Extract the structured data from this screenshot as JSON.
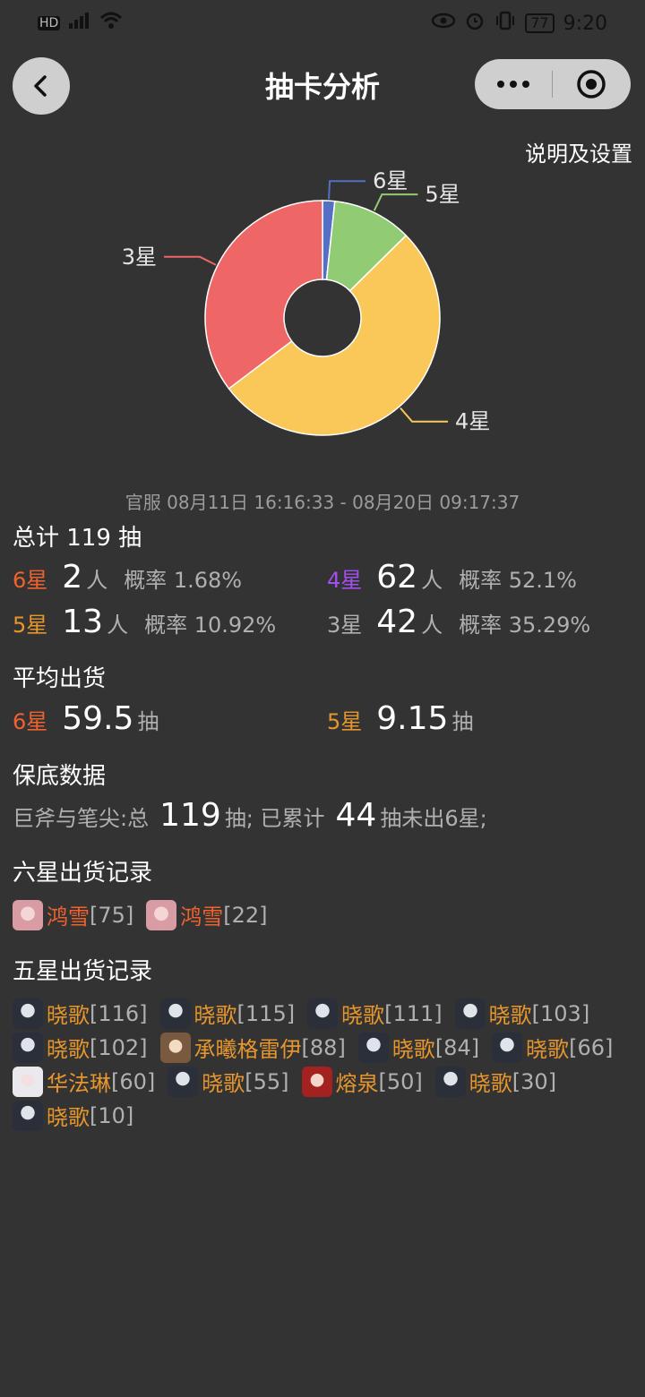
{
  "status_bar": {
    "left_icons": [
      "hd-icon",
      "4g-signal-icon",
      "wifi-icon"
    ],
    "right_icons": [
      "eye-icon",
      "alarm-icon",
      "vibrate-icon"
    ],
    "battery": "77",
    "time": "9:20"
  },
  "nav": {
    "title": "抽卡分析",
    "more_icon": "more-dots-icon",
    "target_icon": "target-icon"
  },
  "settings_label": "说明及设置",
  "colors": {
    "six_star": "#5470c6",
    "five_star": "#91cc75",
    "four_star": "#fac858",
    "three_star": "#ee6666"
  },
  "chart_data": {
    "type": "pie",
    "labels": [
      "6星",
      "5星",
      "4星",
      "3星"
    ],
    "values": [
      2,
      13,
      62,
      42
    ]
  },
  "time_range": "官服 08月11日 16:16:33 - 08月20日 09:17:37",
  "summary": {
    "total_label": "总计 119 抽",
    "stats": [
      {
        "star": "6星",
        "count": "2",
        "unit": "人",
        "rate": "概率 1.68%"
      },
      {
        "star": "4星",
        "count": "62",
        "unit": "人",
        "rate": "概率 52.1%"
      },
      {
        "star": "5星",
        "count": "13",
        "unit": "人",
        "rate": "概率 10.92%"
      },
      {
        "star": "3星",
        "count": "42",
        "unit": "人",
        "rate": "概率 35.29%"
      }
    ]
  },
  "average": {
    "title": "平均出货",
    "six": {
      "star": "6星",
      "value": "59.5",
      "unit": "抽"
    },
    "five": {
      "star": "5星",
      "value": "9.15",
      "unit": "抽"
    }
  },
  "pity": {
    "title": "保底数据",
    "pool_label": "巨斧与笔尖:总",
    "total": "119",
    "mid": "抽; 已累计",
    "since": "44",
    "tail": "抽未出6星;"
  },
  "six_star_records": {
    "title": "六星出货记录",
    "items": [
      {
        "name": "鸿雪",
        "count": "[75]"
      },
      {
        "name": "鸿雪",
        "count": "[22]"
      }
    ]
  },
  "five_star_records": {
    "title": "五星出货记录",
    "items": [
      {
        "name": "晓歌",
        "count": "[116]"
      },
      {
        "name": "晓歌",
        "count": "[115]"
      },
      {
        "name": "晓歌",
        "count": "[111]"
      },
      {
        "name": "晓歌",
        "count": "[103]"
      },
      {
        "name": "晓歌",
        "count": "[102]"
      },
      {
        "name": "承曦格雷伊",
        "count": "[88]"
      },
      {
        "name": "晓歌",
        "count": "[84]"
      },
      {
        "name": "晓歌",
        "count": "[66]"
      },
      {
        "name": "华法琳",
        "count": "[60]"
      },
      {
        "name": "晓歌",
        "count": "[55]"
      },
      {
        "name": "熔泉",
        "count": "[50]"
      },
      {
        "name": "晓歌",
        "count": "[30]"
      },
      {
        "name": "晓歌",
        "count": "[10]"
      }
    ]
  }
}
